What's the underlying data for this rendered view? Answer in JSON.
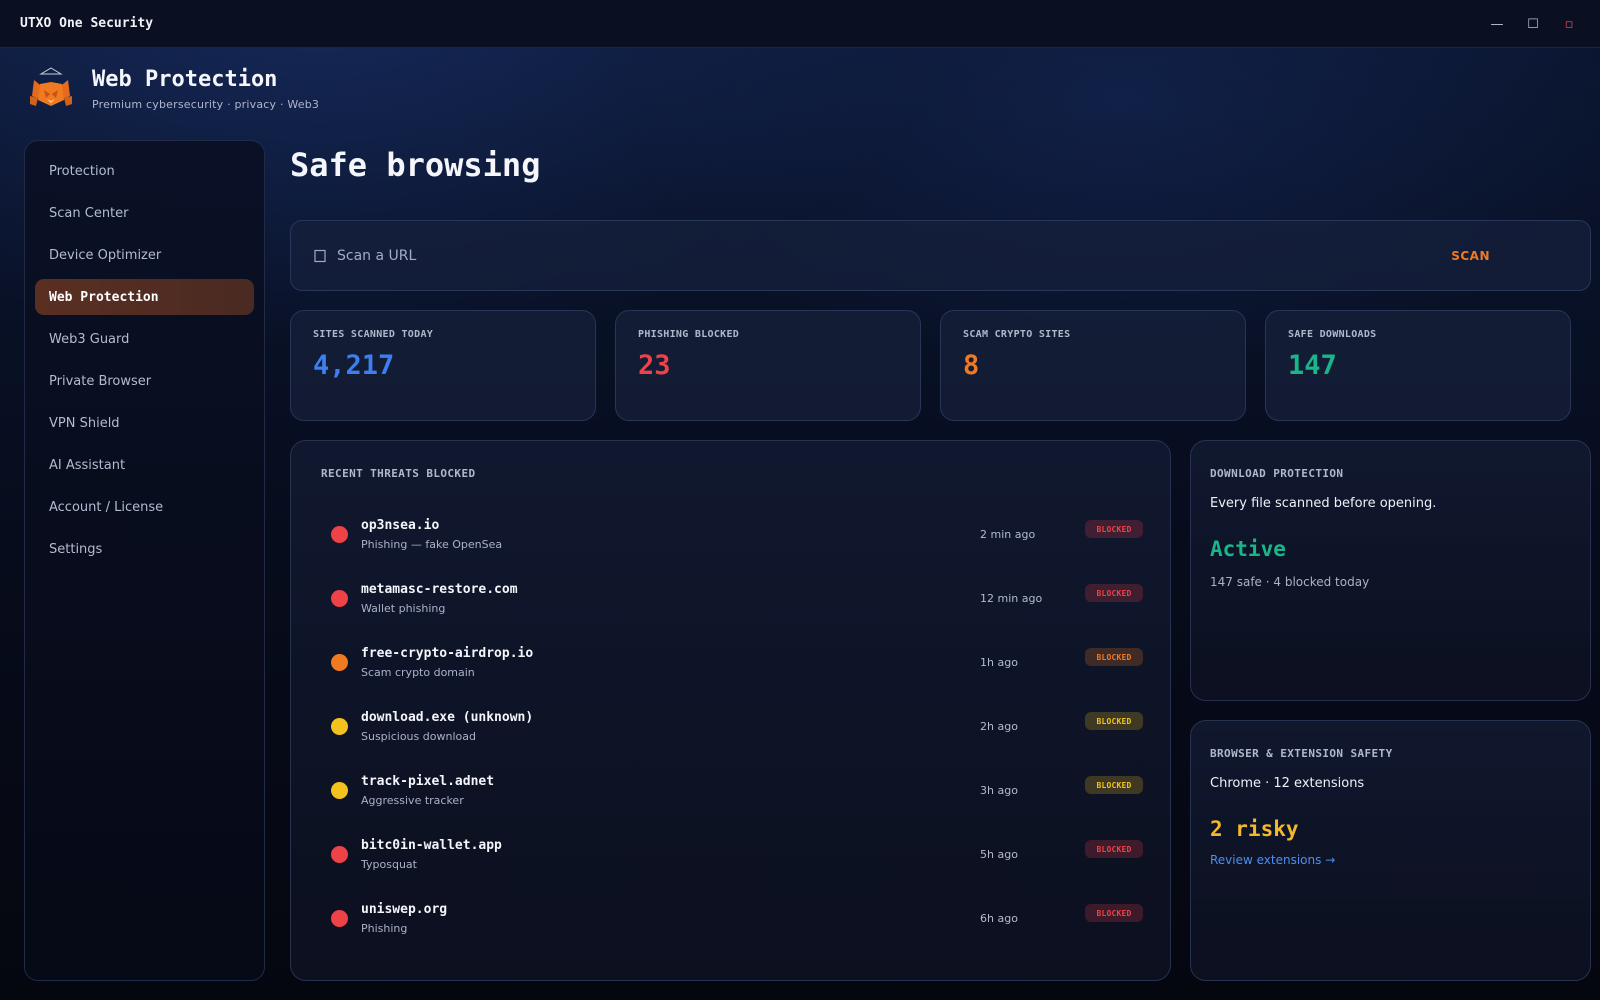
{
  "window": {
    "title": "UTXO One Security",
    "controls": {
      "minimize": "—",
      "maximize": "☐",
      "close": "▫"
    }
  },
  "brand": {
    "title": "Web Protection",
    "subtitle": "Premium cybersecurity · privacy · Web3",
    "logo_icon": "fox-logo-icon"
  },
  "sidebar": {
    "items": [
      {
        "label": "Protection",
        "active": false
      },
      {
        "label": "Scan Center",
        "active": false
      },
      {
        "label": "Device Optimizer",
        "active": false
      },
      {
        "label": "Web Protection",
        "active": true
      },
      {
        "label": "Web3 Guard",
        "active": false
      },
      {
        "label": "Private Browser",
        "active": false
      },
      {
        "label": "VPN Shield",
        "active": false
      },
      {
        "label": "AI Assistant",
        "active": false
      },
      {
        "label": "Account / License",
        "active": false
      },
      {
        "label": "Settings",
        "active": false
      }
    ]
  },
  "page": {
    "title": "Safe browsing"
  },
  "scan": {
    "placeholder": "Scan a URL",
    "value": "",
    "button_label": "SCAN"
  },
  "stats": [
    {
      "label": "SITES SCANNED TODAY",
      "value": "4,217",
      "color": "#3d7ff0"
    },
    {
      "label": "PHISHING BLOCKED",
      "value": "23",
      "color": "#ec4248"
    },
    {
      "label": "SCAM CRYPTO SITES",
      "value": "8",
      "color": "#f07a22"
    },
    {
      "label": "SAFE DOWNLOADS",
      "value": "147",
      "color": "#1bb58a"
    }
  ],
  "threats": {
    "title": "RECENT THREATS BLOCKED",
    "items": [
      {
        "domain": "op3nsea.io",
        "desc": "Phishing — fake OpenSea",
        "time": "2 min ago",
        "badge": "BLOCKED",
        "color": "#ec4248"
      },
      {
        "domain": "metamasc-restore.com",
        "desc": "Wallet phishing",
        "time": "12 min ago",
        "badge": "BLOCKED",
        "color": "#ec4248"
      },
      {
        "domain": "free-crypto-airdrop.io",
        "desc": "Scam crypto domain",
        "time": "1h ago",
        "badge": "BLOCKED",
        "color": "#f07a22"
      },
      {
        "domain": "download.exe (unknown)",
        "desc": "Suspicious download",
        "time": "2h ago",
        "badge": "BLOCKED",
        "color": "#f3c21f"
      },
      {
        "domain": "track-pixel.adnet",
        "desc": "Aggressive tracker",
        "time": "3h ago",
        "badge": "BLOCKED",
        "color": "#f3c21f"
      },
      {
        "domain": "bitc0in-wallet.app",
        "desc": "Typosquat",
        "time": "5h ago",
        "badge": "BLOCKED",
        "color": "#ec4248"
      },
      {
        "domain": "uniswep.org",
        "desc": "Phishing",
        "time": "6h ago",
        "badge": "BLOCKED",
        "color": "#ec4248"
      }
    ]
  },
  "download_protection": {
    "title": "DOWNLOAD PROTECTION",
    "text": "Every file scanned before opening.",
    "status": "Active",
    "summary": "147 safe · 4 blocked today"
  },
  "browser_safety": {
    "title": "BROWSER & EXTENSION SAFETY",
    "text": "Chrome · 12 extensions",
    "status": "2 risky",
    "link": "Review extensions →"
  }
}
